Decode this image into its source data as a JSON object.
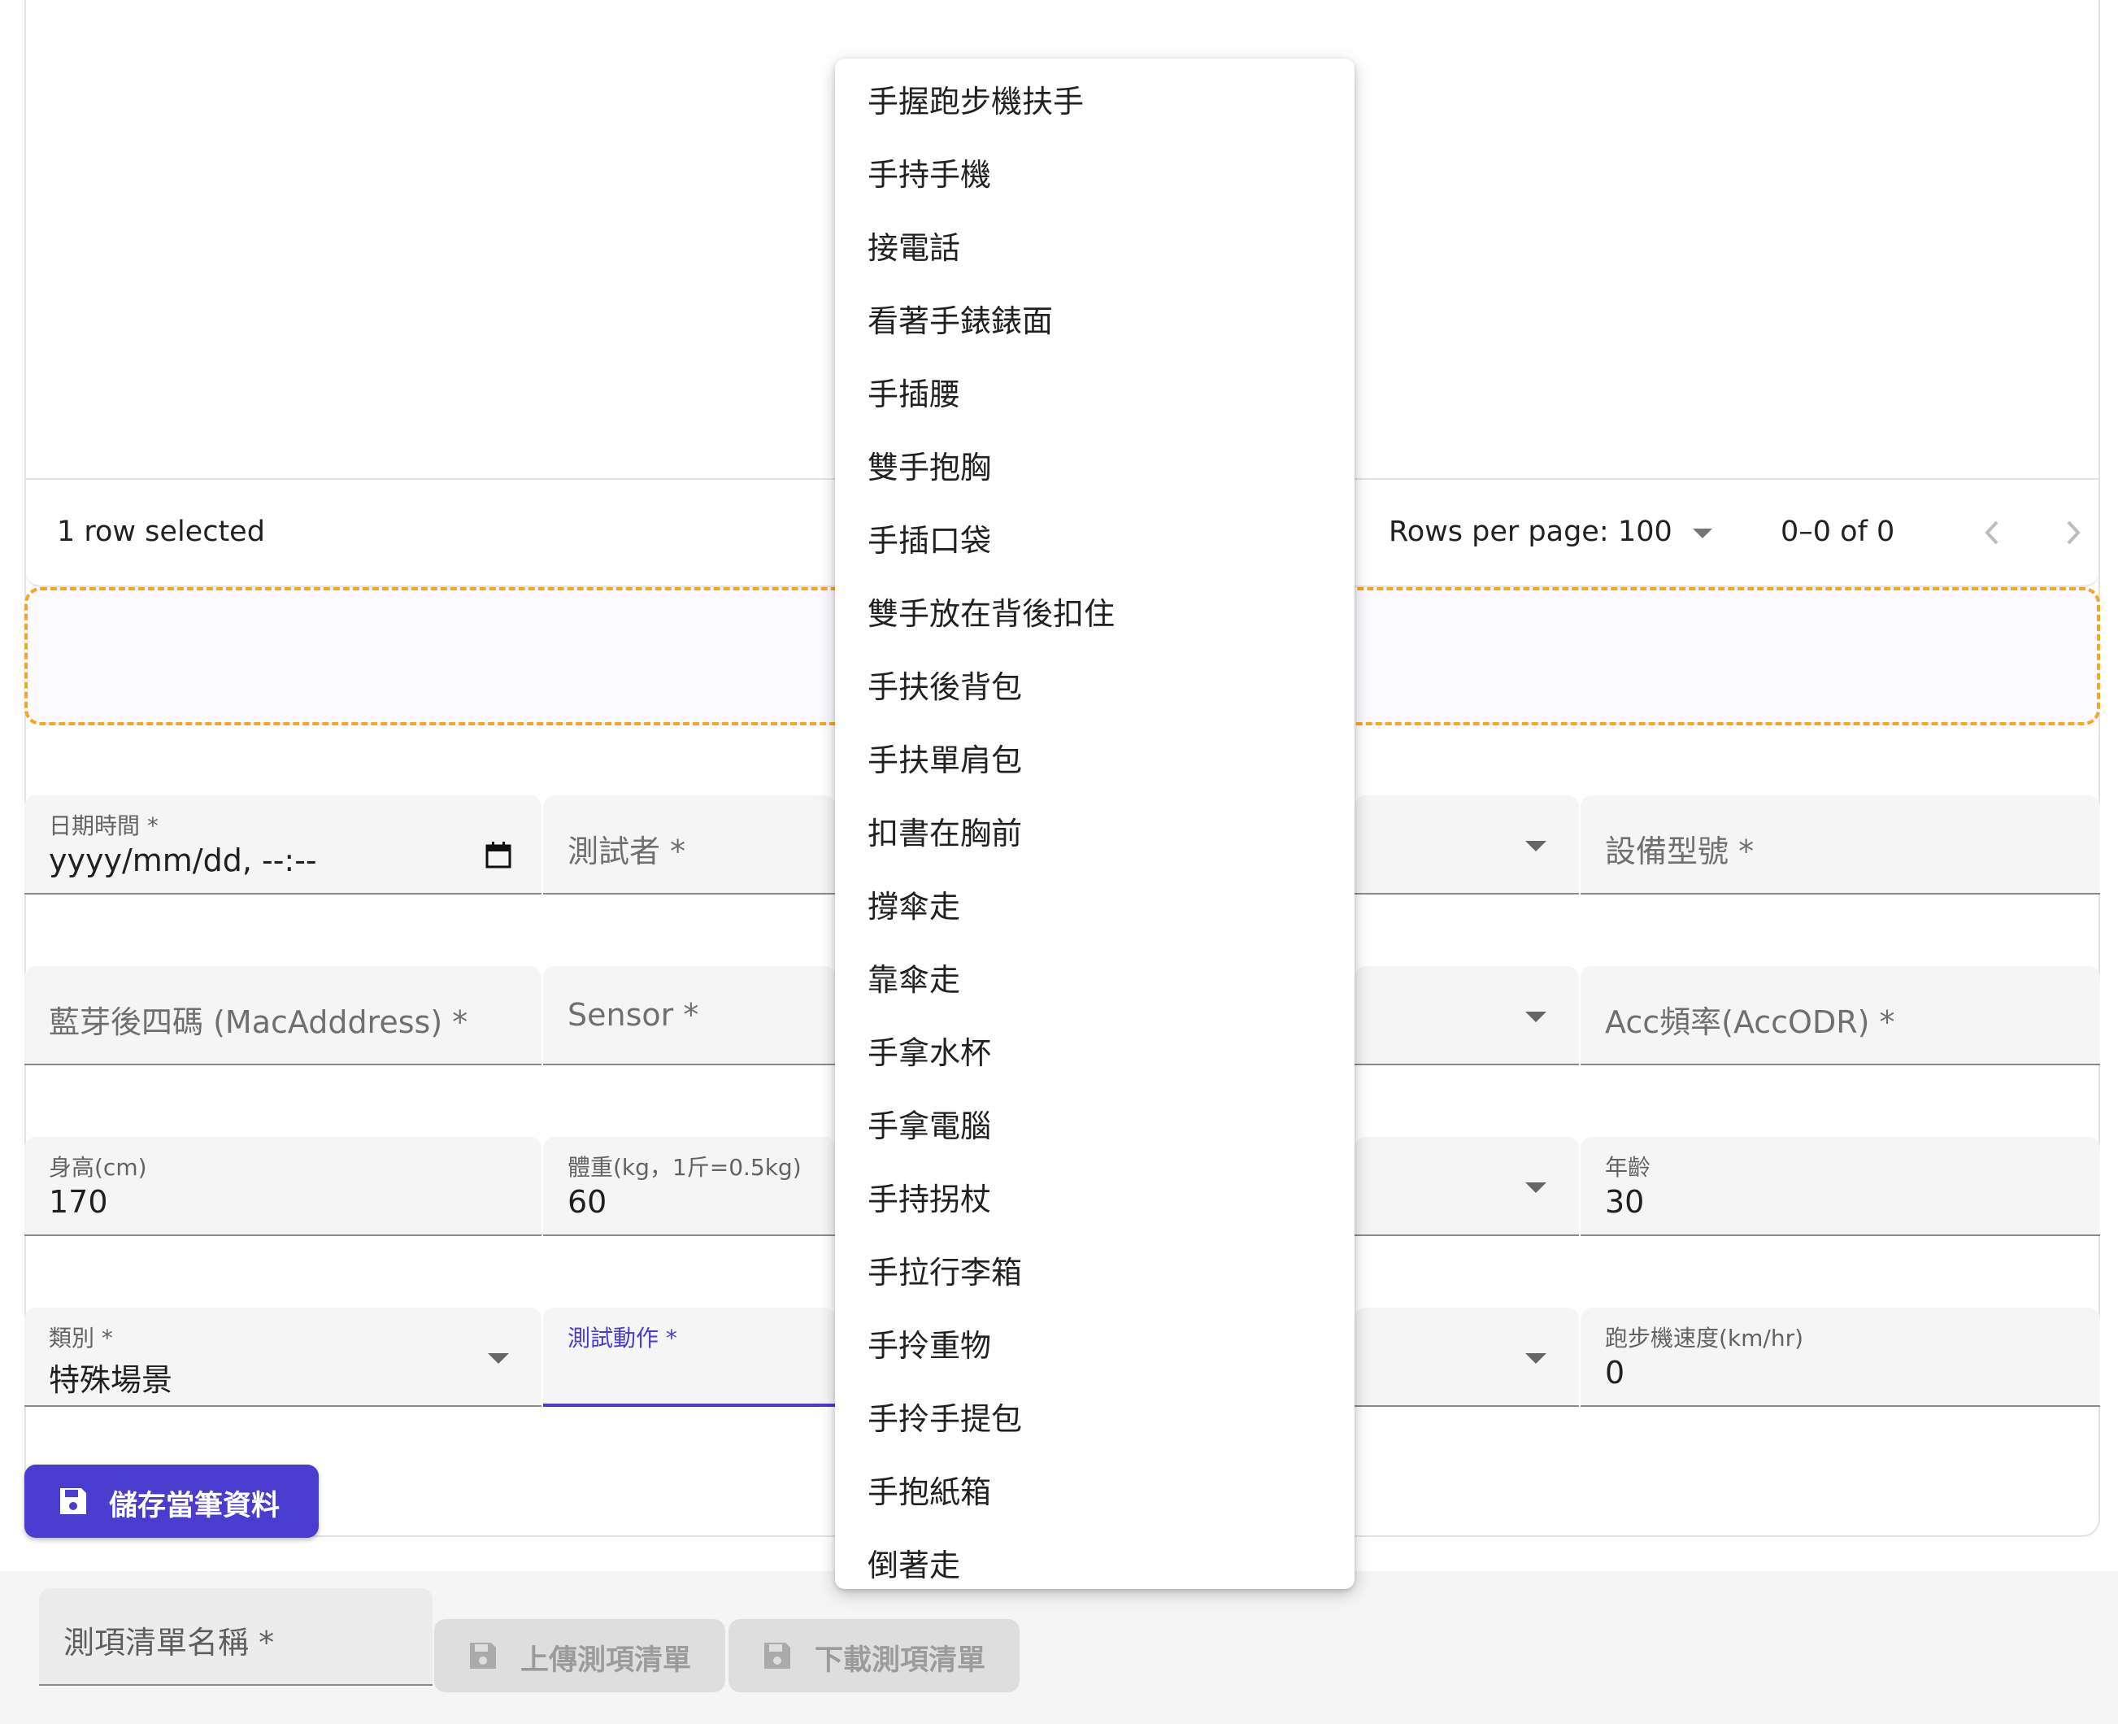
{
  "grid": {
    "selected_text": "1 row selected",
    "rows_per_page_label": "Rows per page:",
    "rows_per_page_value": "100",
    "range_text": "0–0 of 0"
  },
  "form": {
    "datetime": {
      "label": "日期時間 *",
      "value": "yyyy/mm/dd, --:--"
    },
    "tester": {
      "label": "測試者 *"
    },
    "device_model": {
      "label": "設備型號 *"
    },
    "mac": {
      "label": "藍芽後四碼 (MacAdddress) *"
    },
    "sensor": {
      "label": "Sensor *"
    },
    "acc_odr": {
      "label": "Acc頻率(AccODR) *"
    },
    "height": {
      "label": "身高(cm)",
      "value": "170"
    },
    "weight": {
      "label": "體重(kg，1斤=0.5kg)",
      "value": "60"
    },
    "age": {
      "label": "年齡",
      "value": "30"
    },
    "category": {
      "label": "類別 *",
      "value": "特殊場景"
    },
    "test_action": {
      "label": "測試動作 *"
    },
    "treadmill_speed": {
      "label": "跑步機速度(km/hr)",
      "value": "0"
    },
    "save_button": "儲存當筆資料"
  },
  "bottom": {
    "list_name_label": "測項清單名稱 *",
    "upload_button": "上傳測項清單",
    "download_button": "下載測項清單"
  },
  "menu": {
    "items": [
      "手握跑步機扶手",
      "手持手機",
      "接電話",
      "看著手錶錶面",
      "手插腰",
      "雙手抱胸",
      "手插口袋",
      "雙手放在背後扣住",
      "手扶後背包",
      "手扶單肩包",
      "扣書在胸前",
      "撐傘走",
      "靠傘走",
      "手拿水杯",
      "手拿電腦",
      "手持拐杖",
      "手拉行李箱",
      "手拎重物",
      "手拎手提包",
      "手抱紙箱",
      "倒著走"
    ]
  },
  "colors": {
    "primary": "#4a3ccf",
    "dropzone_border": "#f5a623"
  },
  "icons": {
    "save": "save-icon",
    "calendar": "calendar-icon",
    "prev": "chevron-left-icon",
    "next": "chevron-right-icon"
  }
}
